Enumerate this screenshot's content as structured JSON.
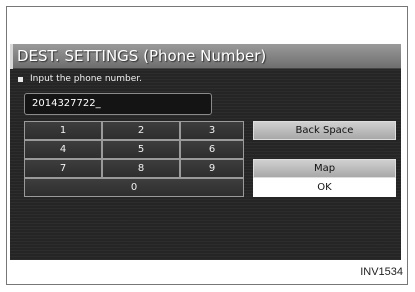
{
  "screen": {
    "title": "DEST. SETTINGS (Phone Number)",
    "instruction": "Input the phone number.",
    "phone_value": "2014327722_"
  },
  "keypad": {
    "keys": [
      "1",
      "2",
      "3",
      "4",
      "5",
      "6",
      "7",
      "8",
      "9",
      "0"
    ]
  },
  "actions": {
    "back_space": "Back Space",
    "map": "Map",
    "ok": "OK"
  },
  "figure_caption": "INV1534"
}
